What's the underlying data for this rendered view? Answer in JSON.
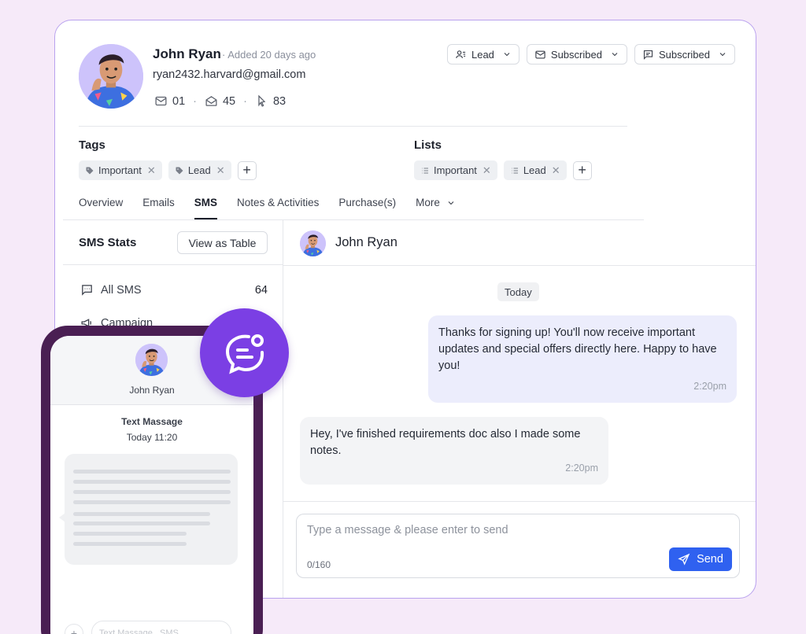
{
  "contact": {
    "name": "John Ryan",
    "added": "Added 20 days ago",
    "email": "ryan2432.harvard@gmail.com",
    "stats": {
      "emails": "01",
      "opens": "45",
      "clicks": "83"
    }
  },
  "header_buttons": [
    {
      "label": "Lead",
      "icon": "user-lines-icon"
    },
    {
      "label": "Subscribed",
      "icon": "mail-icon"
    },
    {
      "label": "Subscribed",
      "icon": "message-square-icon"
    }
  ],
  "tags": {
    "title": "Tags",
    "items": [
      "Important",
      "Lead"
    ]
  },
  "lists": {
    "title": "Lists",
    "items": [
      "Important",
      "Lead"
    ]
  },
  "tabs": [
    "Overview",
    "Emails",
    "SMS",
    "Notes & Activities",
    "Purchase(s)",
    "More"
  ],
  "active_tab": "SMS",
  "sms_stats": {
    "title": "SMS Stats",
    "view_button": "View as Table",
    "items": [
      {
        "label": "All SMS",
        "count": "64"
      },
      {
        "label": "Campaign",
        "count": ""
      }
    ]
  },
  "chat": {
    "contact_name": "John Ryan",
    "date_label": "Today",
    "messages": [
      {
        "direction": "outgoing",
        "text": "Thanks for signing up! You'll now receive important updates and special offers directly here. Happy to have you!",
        "time": "2:20pm"
      },
      {
        "direction": "incoming",
        "text": "Hey, I've finished requirements doc also I made some notes.",
        "time": "2:20pm"
      }
    ],
    "composer": {
      "placeholder": "Type a message & please enter to send",
      "counter": "0/160",
      "send_label": "Send"
    }
  },
  "phone": {
    "contact_name": "John Ryan",
    "message_title": "Text Massage",
    "message_time": "Today 11:20",
    "input_placeholder": "Text Massage...SMS"
  },
  "colors": {
    "accent": "#2f61f0",
    "badge": "#7b3fe4",
    "outgoing_bubble": "#ecedfc",
    "phone_frame": "#4a1f53"
  }
}
